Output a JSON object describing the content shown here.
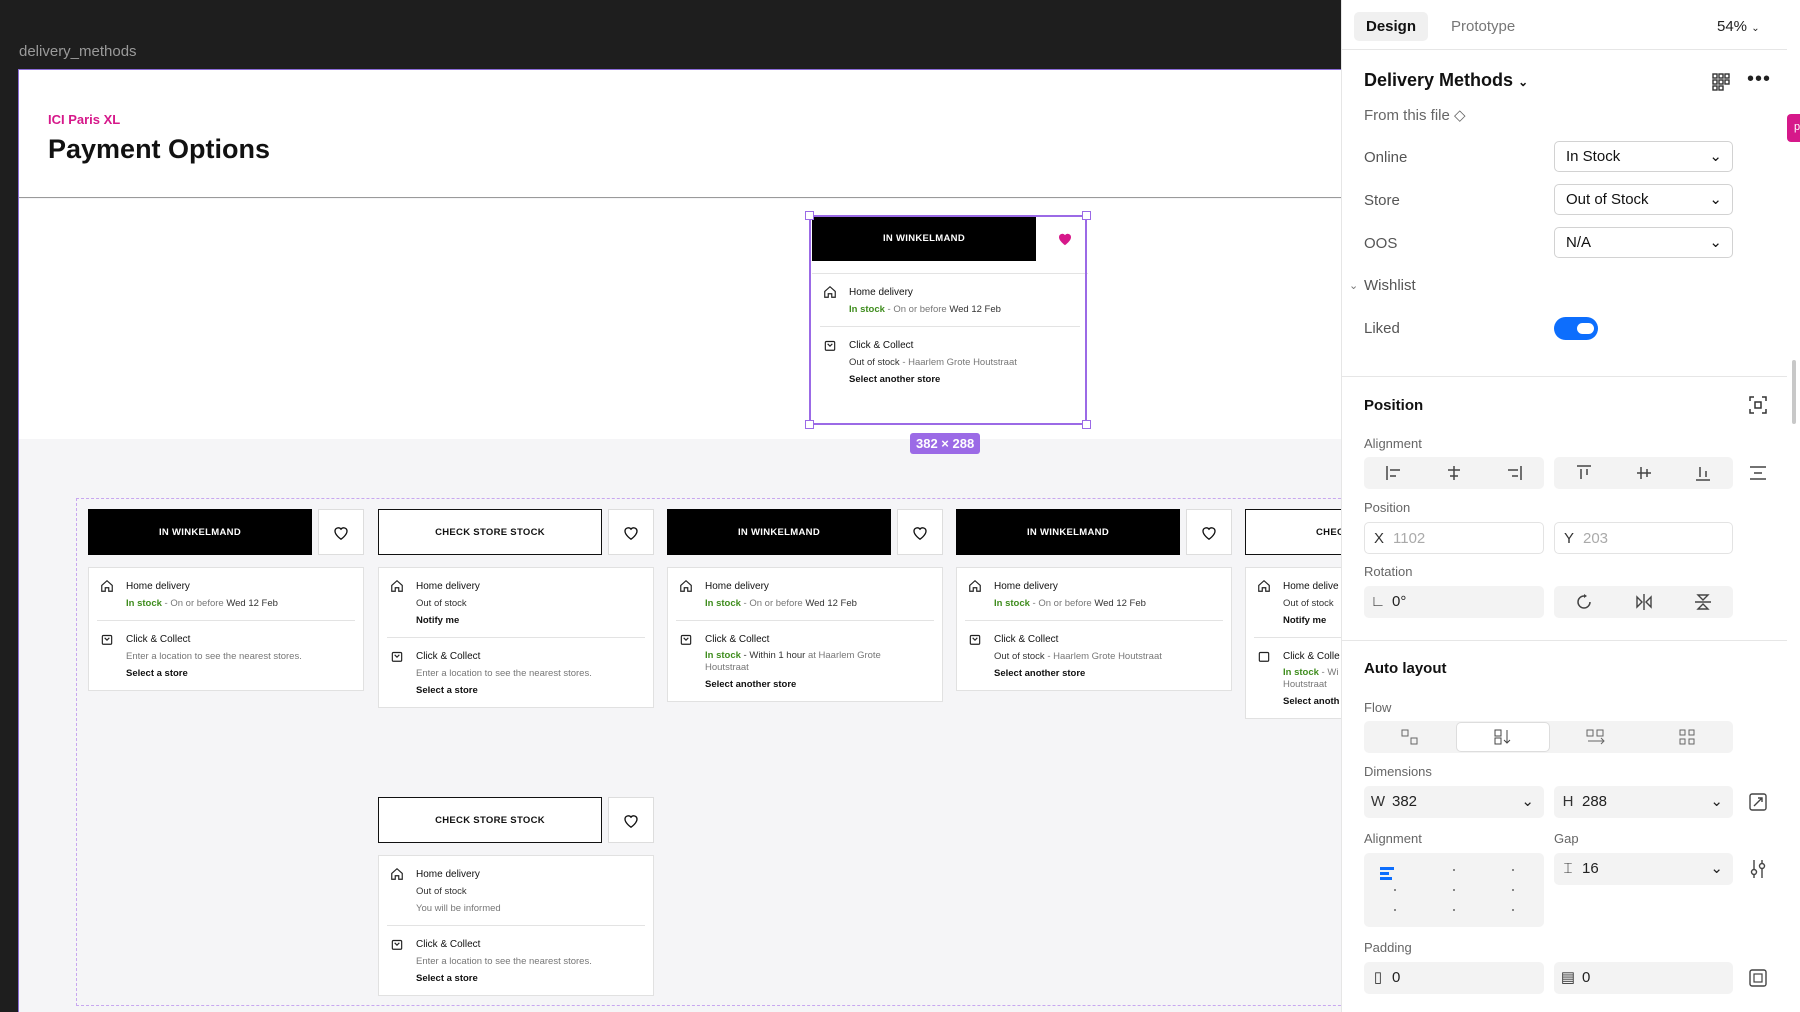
{
  "canvas": {
    "frame_label": "delivery_methods",
    "brand": "ICI Paris XL",
    "page_title": "Payment Options",
    "selection_dims": "382 × 288"
  },
  "selected_card": {
    "button": "IN WINKELMAND",
    "home_label": "Home delivery",
    "home_status": "In stock",
    "home_detail": " - On or before ",
    "home_date": "Wed 12 Feb",
    "cc_label": "Click & Collect",
    "cc_status": "Out of stock",
    "cc_detail": " - Haarlem Grote Houtstraat",
    "cc_link": "Select another store"
  },
  "cards": [
    {
      "button": "IN WINKELMAND",
      "home": "Home delivery",
      "home_status": "In stock",
      "home_detail": " - On or before ",
      "home_date": "Wed 12 Feb",
      "cc": "Click & Collect",
      "cc_line": "Enter a location to see the nearest stores.",
      "cc_link": "Select a store"
    },
    {
      "button": "CHECK STORE STOCK",
      "home": "Home delivery",
      "home_oos": "Out of stock",
      "home_link": "Notify me",
      "cc": "Click & Collect",
      "cc_line": "Enter a location to see the nearest stores.",
      "cc_link": "Select a store"
    },
    {
      "button": "IN WINKELMAND",
      "home": "Home delivery",
      "home_status": "In stock",
      "home_detail": " - On or before ",
      "home_date": "Wed 12 Feb",
      "cc": "Click & Collect",
      "cc_status": "In stock",
      "cc_detail": " - Within 1 hour ",
      "cc_at": "at Haarlem Grote",
      "cc_at2": "Houtstraat",
      "cc_link": "Select another store"
    },
    {
      "button": "IN WINKELMAND",
      "home": "Home delivery",
      "home_status": "In stock",
      "home_detail": " - On or before ",
      "home_date": "Wed 12 Feb",
      "cc": "Click & Collect",
      "cc_oos": "Out of stock",
      "cc_detail": " - Haarlem Grote Houtstraat",
      "cc_link": "Select another store"
    },
    {
      "button": "CHECK",
      "home": "Home delive",
      "home_oos": "Out of stock",
      "home_link": "Notify me",
      "cc": "Click & Colle",
      "cc_status": "In stock",
      "cc_detail": " - Wi",
      "cc_at2": "Houtstraat",
      "cc_link": "Select anoth"
    }
  ],
  "bottom_card": {
    "button": "CHECK STORE STOCK",
    "home": "Home delivery",
    "home_oos": "Out of stock",
    "home_note": "You will be informed",
    "cc": "Click & Collect",
    "cc_line": "Enter a location to see the nearest stores.",
    "cc_link": "Select a store"
  },
  "panel": {
    "tabs": {
      "design": "Design",
      "prototype": "Prototype"
    },
    "zoom": "54%",
    "component_name": "Delivery Methods",
    "source": "From this file",
    "props": [
      {
        "label": "Online",
        "value": "In Stock"
      },
      {
        "label": "Store",
        "value": "Out of Stock"
      },
      {
        "label": "OOS",
        "value": "N/A"
      }
    ],
    "wishlist": {
      "title": "Wishlist",
      "liked_label": "Liked",
      "liked": true
    },
    "position": {
      "title": "Position",
      "alignment_label": "Alignment",
      "position_label": "Position",
      "x": "1102",
      "y": "203",
      "rotation_label": "Rotation",
      "rotation": "0°"
    },
    "auto_layout": {
      "title": "Auto layout",
      "flow_label": "Flow",
      "dimensions_label": "Dimensions",
      "w": "382",
      "h": "288",
      "alignment_label": "Alignment",
      "gap_label": "Gap",
      "gap": "16",
      "padding_label": "Padding",
      "pad_h": "0",
      "pad_v": "0"
    },
    "pink_tag": "pr"
  },
  "colors": {
    "accent": "#9b6ae6",
    "brand": "#d6188a",
    "toggle": "#0d6efd",
    "in_stock": "#3f8d1e"
  }
}
